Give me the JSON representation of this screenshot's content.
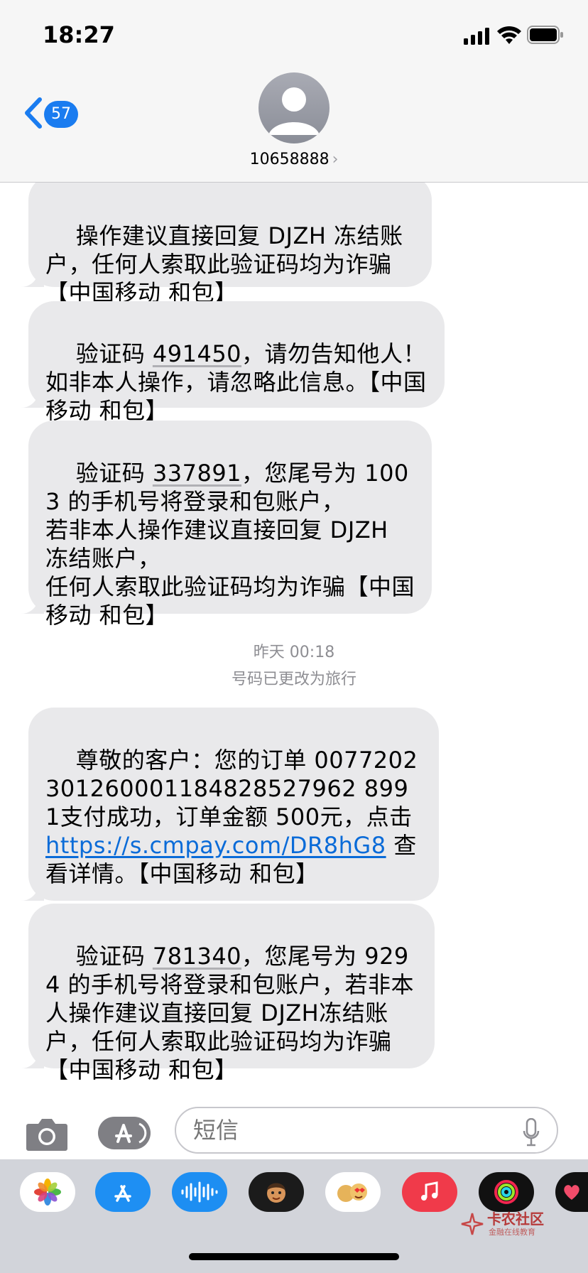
{
  "status_bar": {
    "time": "18:27",
    "signal_icon": "signal-bars-icon",
    "wifi_icon": "wifi-icon",
    "battery_icon": "battery-icon"
  },
  "header": {
    "back_icon": "chevron-left-icon",
    "unread_count": "57",
    "contact_name": "10658888",
    "contact_chevron": "›",
    "avatar_icon": "person-avatar-icon"
  },
  "messages": [
    {
      "id": "m1",
      "text": "操作建议直接回复 DJZH 冻结账户，任何人索取此验证码均为诈骗【中国移动 和包】",
      "partial": true
    },
    {
      "id": "m2",
      "prefix": "验证码 ",
      "code": "491450",
      "suffix": "，请勿告知他人！如非本人操作，请忽略此信息。【中国移动 和包】"
    },
    {
      "id": "m3",
      "prefix": "验证码 ",
      "code": "337891",
      "suffix": "，您尾号为 1003 的手机号将登录和包账户，\n若非本人操作建议直接回复 DJZH 冻结账户，\n任何人索取此验证码均为诈骗【中国移动 和包】"
    },
    {
      "id": "m4",
      "prefix": "尊敬的客户：您的订单 0077202301260001184828527962 8991支付成功，订单金额 500元，点击 ",
      "link": "https://s.cmpay.com/DR8hG8",
      "suffix": " 查看详情。【中国移动 和包】"
    },
    {
      "id": "m5",
      "prefix": "验证码 ",
      "code": "781340",
      "suffix": "，您尾号为 9294 的手机号将登录和包账户，若非本人操作建议直接回复 DJZH冻结账户，任何人索取此验证码均为诈骗【中国移动 和包】"
    }
  ],
  "timestamp": {
    "label": "昨天 00:18",
    "note": "号码已更改为旅行"
  },
  "input_bar": {
    "placeholder": "短信",
    "camera_icon": "camera-icon",
    "apps_icon": "app-store-icon",
    "mic_icon": "microphone-icon"
  },
  "app_drawer": [
    "photos-icon",
    "app-store-icon",
    "audio-message-icon",
    "memoji-icon",
    "memoji-stickers-icon",
    "music-icon",
    "activity-icon",
    "digital-touch-icon"
  ],
  "watermark": {
    "title": "卡农社区",
    "subtitle": "金融在线教育"
  },
  "colors": {
    "bubble": "#e9e9eb",
    "accent": "#1a7cf0",
    "link": "#0a6bd8",
    "timestamp": "#8e8e93"
  }
}
